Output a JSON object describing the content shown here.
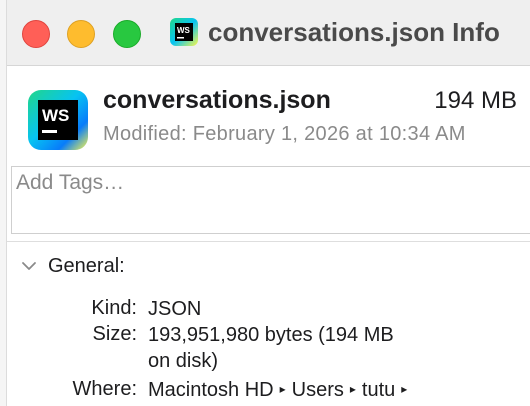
{
  "window": {
    "title": "conversations.json Info",
    "app_icon": "webstorm-icon"
  },
  "header": {
    "file_name": "conversations.json",
    "file_size": "194 MB",
    "modified": "Modified: February 1, 2026 at 10:34 AM",
    "icon": "webstorm-file-icon",
    "icon_text": "WS"
  },
  "tags": {
    "placeholder": "Add Tags…",
    "value": ""
  },
  "general": {
    "title": "General:",
    "expanded": true,
    "rows": {
      "kind": {
        "label": "Kind:",
        "value": "JSON"
      },
      "size": {
        "label": "Size:",
        "value_line1": "193,951,980 bytes (194 MB",
        "value_line2": "on disk)"
      },
      "where": {
        "label": "Where:",
        "path": [
          "Macintosh HD",
          "Users",
          "tutu"
        ],
        "separator": "▸"
      }
    }
  },
  "colors": {
    "close": "#ff5f57",
    "minimize": "#febc2e",
    "zoom": "#28c840",
    "secondary_text": "#8a8a8a"
  }
}
